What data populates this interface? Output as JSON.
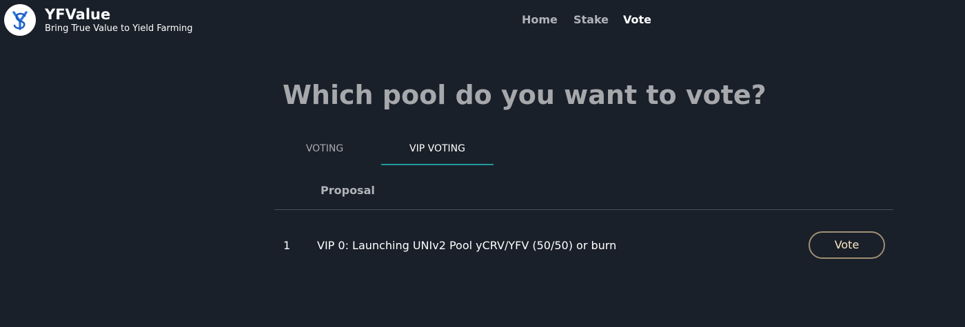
{
  "header": {
    "brand_name": "YFValue",
    "tagline": "Bring True Value to Yield Farming",
    "logo_icon": "yfv-logo-icon",
    "nav": [
      {
        "label": "Home",
        "active": false
      },
      {
        "label": "Stake",
        "active": false
      },
      {
        "label": "Vote",
        "active": true
      }
    ]
  },
  "main": {
    "heading": "Which pool do you want to vote?",
    "tabs": [
      {
        "label": "VOTING",
        "active": false
      },
      {
        "label": "VIP VOTING",
        "active": true
      }
    ],
    "table": {
      "column_header": "Proposal",
      "rows": [
        {
          "index": "1",
          "proposal": "VIP 0: Launching UNIv2 Pool yCRV/YFV (50/50) or burn",
          "action_label": "Vote"
        }
      ]
    }
  },
  "colors": {
    "background": "#1a202a",
    "tab_underline": "#1d9a9a",
    "vote_button_border": "#9f8f73",
    "vote_button_text": "#f7e9c4",
    "logo_blue": "#2f78e0"
  }
}
